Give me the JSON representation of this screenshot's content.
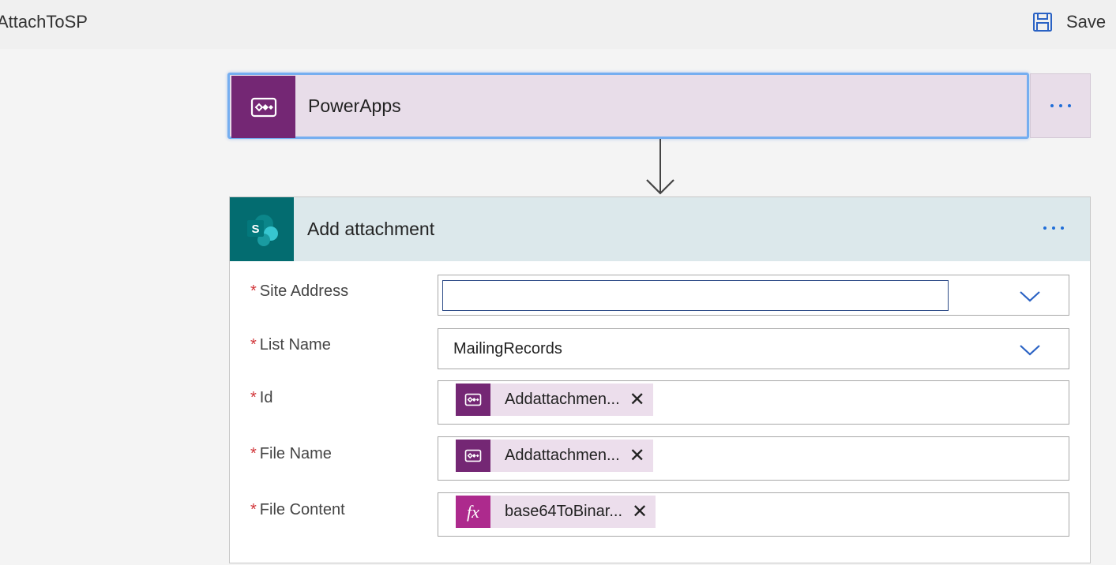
{
  "flow": {
    "title": "AttachToSP"
  },
  "toolbar": {
    "save_label": "Save",
    "save_icon": "save-icon"
  },
  "trigger": {
    "title": "PowerApps",
    "icon": "powerapps-icon",
    "color": "#742774"
  },
  "action": {
    "title": "Add attachment",
    "icon": "sharepoint-icon",
    "color": "#036c70",
    "fields": {
      "site_address": {
        "label": "Site Address",
        "required": "*",
        "value": ""
      },
      "list_name": {
        "label": "List Name",
        "required": "*",
        "value": "MailingRecords"
      },
      "id": {
        "label": "Id",
        "required": "*",
        "token": "Addattachmen...",
        "token_icon": "powerapps-icon"
      },
      "file_name": {
        "label": "File Name",
        "required": "*",
        "token": "Addattachmen...",
        "token_icon": "powerapps-icon"
      },
      "file_content": {
        "label": "File Content",
        "required": "*",
        "token": "base64ToBinar...",
        "token_icon": "fx-icon",
        "token_icon_text": "fx"
      }
    }
  },
  "colors": {
    "accent_blue": "#1f6dd8",
    "required_red": "#d13438",
    "token_bg": "#ecdeec",
    "trigger_bg": "#e8dde9",
    "action_header_bg": "#dce8eb"
  }
}
